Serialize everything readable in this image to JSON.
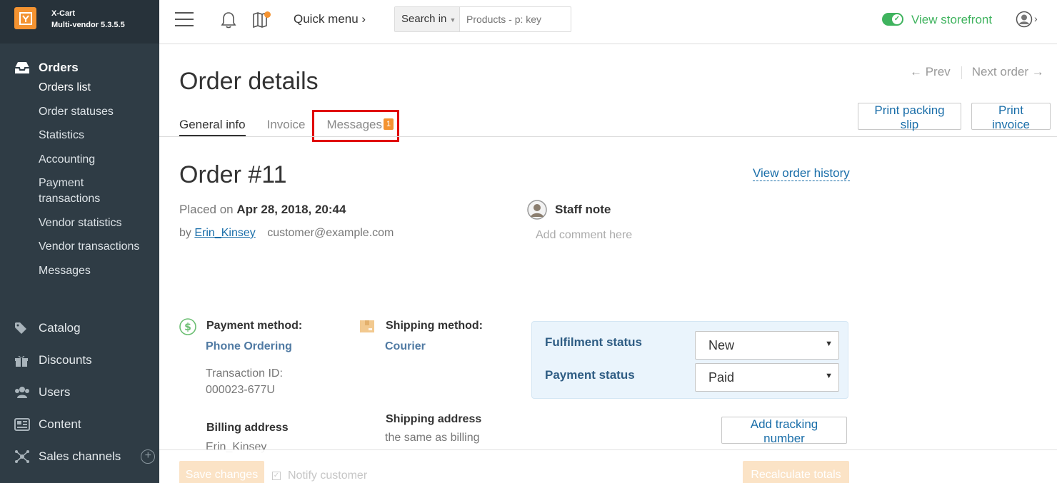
{
  "brand": {
    "name": "X-Cart",
    "version": "Multi-vendor 5.3.5.5"
  },
  "sidebar": {
    "orders_title": "Orders",
    "order_items": [
      {
        "label": "Orders list"
      },
      {
        "label": "Order statuses"
      },
      {
        "label": "Statistics"
      },
      {
        "label": "Accounting"
      },
      {
        "label": "Payment transactions"
      },
      {
        "label": "Vendor statistics"
      },
      {
        "label": "Vendor transactions"
      },
      {
        "label": "Messages"
      }
    ],
    "main_items": [
      {
        "label": "Catalog",
        "icon": "tags-icon"
      },
      {
        "label": "Discounts",
        "icon": "gift-icon"
      },
      {
        "label": "Users",
        "icon": "users-icon"
      },
      {
        "label": "Content",
        "icon": "newspaper-icon"
      },
      {
        "label": "Sales channels",
        "icon": "network-icon"
      }
    ]
  },
  "topbar": {
    "quick_menu": "Quick menu ›",
    "search_in": "Search in",
    "search_placeholder": "Products - p: key",
    "view_storefront": "View storefront"
  },
  "page": {
    "title": "Order details",
    "prev": "← Prev",
    "next": "Next order →",
    "tabs": [
      {
        "label": "General info"
      },
      {
        "label": "Invoice"
      },
      {
        "label": "Messages",
        "badge": "1"
      }
    ],
    "print_packing_slip": "Print packing slip",
    "print_invoice": "Print invoice"
  },
  "order": {
    "number": "Order #11",
    "view_history": "View order history",
    "placed_on_prefix": "Placed on",
    "placed_on_date": "Apr 28, 2018, 20:44",
    "by_prefix": "by",
    "customer_name": "Erin_Kinsey",
    "customer_email": "customer@example.com",
    "staff_note_label": "Staff note",
    "staff_note_placeholder": "Add comment here",
    "payment_method_label": "Payment method:",
    "payment_method": "Phone Ordering",
    "transaction_id_label": "Transaction ID:",
    "transaction_id": "000023-677U",
    "shipping_method_label": "Shipping method:",
    "shipping_method": "Courier",
    "billing_address_label": "Billing address",
    "billing_name": "Erin_Kinsey",
    "shipping_address_label": "Shipping address",
    "shipping_address_value": "the same as billing",
    "fulfilment_status_label": "Fulfilment status",
    "fulfilment_status": "New",
    "payment_status_label": "Payment status",
    "payment_status": "Paid",
    "add_tracking": "Add tracking number"
  },
  "footer": {
    "save_changes": "Save changes",
    "notify_customer": "Notify customer",
    "recalculate_totals": "Recalculate totals"
  },
  "colors": {
    "sidebar_bg": "#2f3c45",
    "accent_orange": "#f49331",
    "link_blue": "#1a6ea9",
    "storefront_green": "#3fb35e",
    "highlight_red": "#e00000"
  }
}
